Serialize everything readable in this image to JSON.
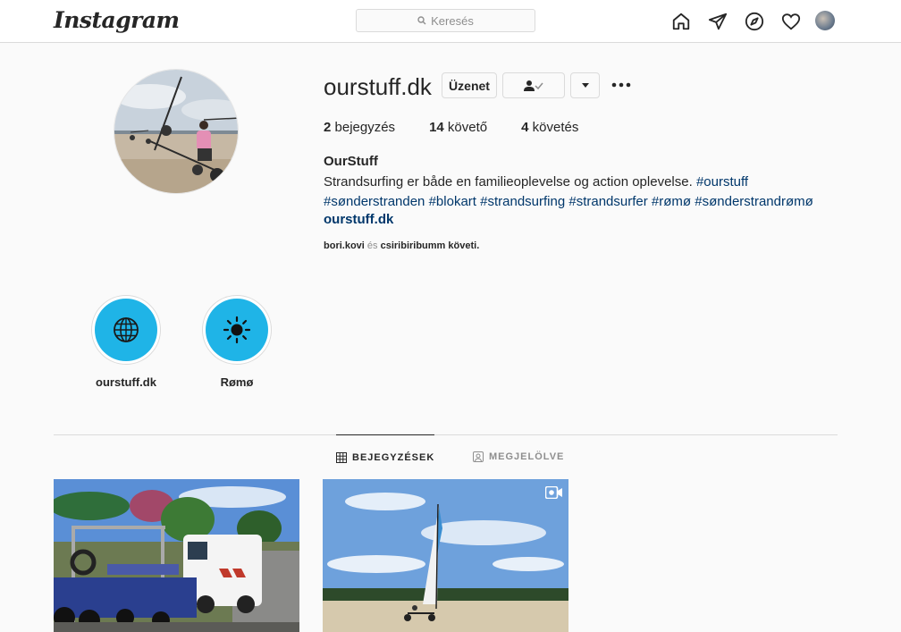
{
  "header": {
    "logo": "Instagram",
    "search_placeholder": "Keresés",
    "icons": [
      "home-icon",
      "direct-icon",
      "explore-icon",
      "activity-icon",
      "avatar"
    ]
  },
  "profile": {
    "username": "ourstuff.dk",
    "message_button": "Üzenet",
    "stats": {
      "posts_count": "2",
      "posts_label": "bejegyzés",
      "followers_count": "14",
      "followers_label": "követő",
      "following_count": "4",
      "following_label": "követés"
    },
    "full_name": "OurStuff",
    "bio_text": "Strandsurfing er både en familieoplevelse og action oplevelse.",
    "hashtags": [
      "#ourstuff",
      "#sønderstranden",
      "#blokart",
      "#strandsurfing",
      "#strandsurfer",
      "#rømø",
      "#sønderstrandrømø"
    ],
    "website": "ourstuff.dk",
    "followed_by": {
      "user1": "bori.kovi",
      "and": "és",
      "user2": "csiribiribumm",
      "suffix": "követi."
    }
  },
  "highlights": [
    {
      "label": "ourstuff.dk",
      "icon": "globe-icon"
    },
    {
      "label": "Rømø",
      "icon": "sun-icon"
    }
  ],
  "tabs": {
    "posts": "BEJEGYZÉSEK",
    "tagged": "MEGJELÖLVE"
  },
  "colors": {
    "accent_link": "#00376b",
    "highlight_bg": "#1fb4e7",
    "border": "#dbdbdb"
  }
}
